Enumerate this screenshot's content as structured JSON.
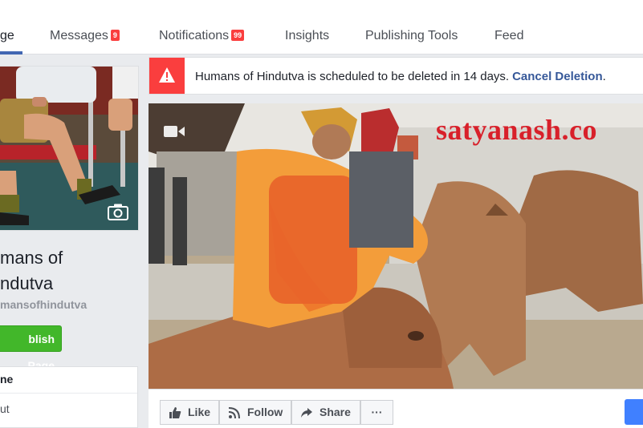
{
  "nav": {
    "tabs": [
      {
        "label": "ge",
        "active": true
      },
      {
        "label": "Messages",
        "badge": "9"
      },
      {
        "label": "Notifications",
        "badge": "99"
      },
      {
        "label": "Insights"
      },
      {
        "label": "Publishing Tools"
      },
      {
        "label": "Feed"
      }
    ]
  },
  "sidebar": {
    "page_name_line1": "mans of",
    "page_name_line2": "ndutva",
    "handle": "mansofhindutva",
    "publish_button": "blish Page",
    "menu_items": [
      "ne",
      "ut"
    ],
    "camera_icon": "camera-icon"
  },
  "alert": {
    "message": "Humans of Hindutva is scheduled to be deleted in 14 days.",
    "link": "Cancel Deletion",
    "tail": ".",
    "icon": "warning-icon",
    "color": "#fa3e3e"
  },
  "cover": {
    "watermark": "satyanash.co",
    "video_icon": "video-camera-icon"
  },
  "actions": {
    "like": "Like",
    "follow": "Follow",
    "share": "Share",
    "more": "···"
  },
  "colors": {
    "accent": "#4267b2",
    "link": "#365899",
    "publish_green": "#42b72a",
    "badge_red": "#fa3e3e",
    "primary_blue": "#4080ff"
  }
}
